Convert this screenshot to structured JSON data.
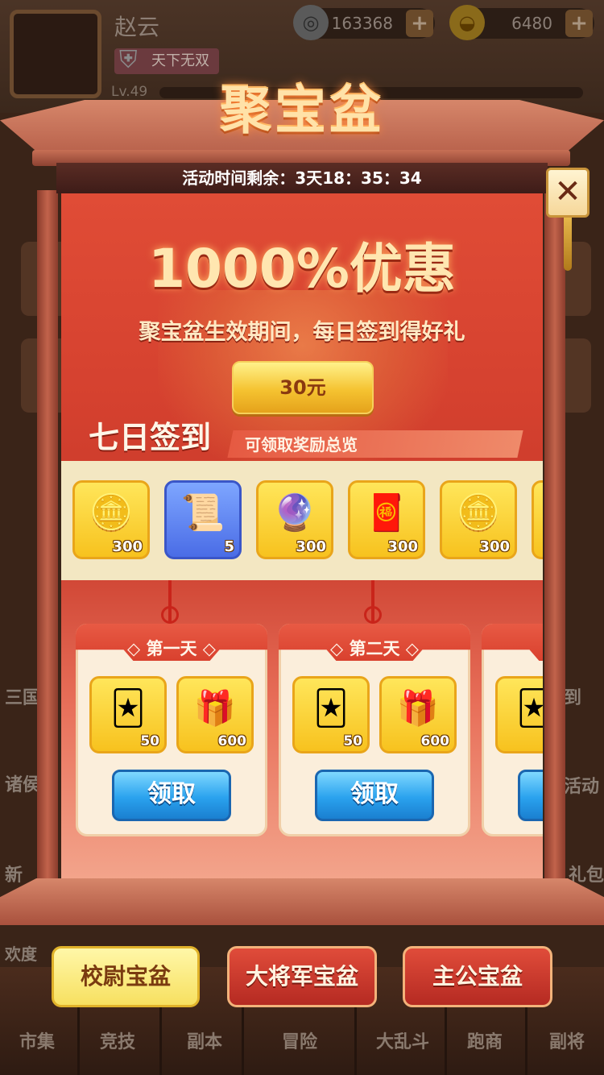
{
  "player": {
    "name": "赵云",
    "title_badge": "天下无双",
    "level": "Lv.49"
  },
  "currencies": {
    "coins": "163368",
    "gold": "6480"
  },
  "background_labels": {
    "left_1": "三国",
    "left_2": "诸侯",
    "left_3": "新",
    "left_4": "欢度",
    "right_1": "到",
    "right_2": "活动",
    "right_3": "礼包"
  },
  "bottom_nav": [
    "市集",
    "竞技",
    "副本",
    "冒险",
    "大乱斗",
    "跑商",
    "副将"
  ],
  "modal": {
    "title": "聚宝盆",
    "timer_text": "活动时间剩余：3天18：35：34",
    "promo_title": "1000%优惠",
    "promo_subtitle": "聚宝盆生效期间，每日签到得好礼",
    "price_button": "30元",
    "sign_title": "七日签到",
    "sign_subtitle": "可领取奖励总览",
    "overview_rewards": [
      {
        "icon": "gold-ingot-icon",
        "glyph": "🪙",
        "count": "300",
        "color": "gold"
      },
      {
        "icon": "speed-scroll-icon",
        "glyph": "📜",
        "count": "5",
        "color": "blue"
      },
      {
        "icon": "purple-orb-icon",
        "glyph": "🔮",
        "count": "300",
        "color": "gold"
      },
      {
        "icon": "red-token-icon",
        "glyph": "🧧",
        "count": "300",
        "color": "gold"
      },
      {
        "icon": "gold-ingot-icon",
        "glyph": "🪙",
        "count": "300",
        "color": "gold"
      }
    ],
    "days": [
      {
        "title": "第一天",
        "items": [
          {
            "icon": "purple-card-icon",
            "glyph": "🃏",
            "count": "50"
          },
          {
            "icon": "gift-box-icon",
            "glyph": "🎁",
            "count": "600"
          }
        ],
        "button": "领取"
      },
      {
        "title": "第二天",
        "items": [
          {
            "icon": "purple-card-icon",
            "glyph": "🃏",
            "count": "50"
          },
          {
            "icon": "gift-box-icon",
            "glyph": "🎁",
            "count": "600"
          }
        ],
        "button": "领取"
      }
    ],
    "close_symbol": "✕"
  },
  "tabs": [
    {
      "label": "校尉宝盆",
      "active": true
    },
    {
      "label": "大将军宝盆",
      "active": false
    },
    {
      "label": "主公宝盆",
      "active": false
    }
  ]
}
